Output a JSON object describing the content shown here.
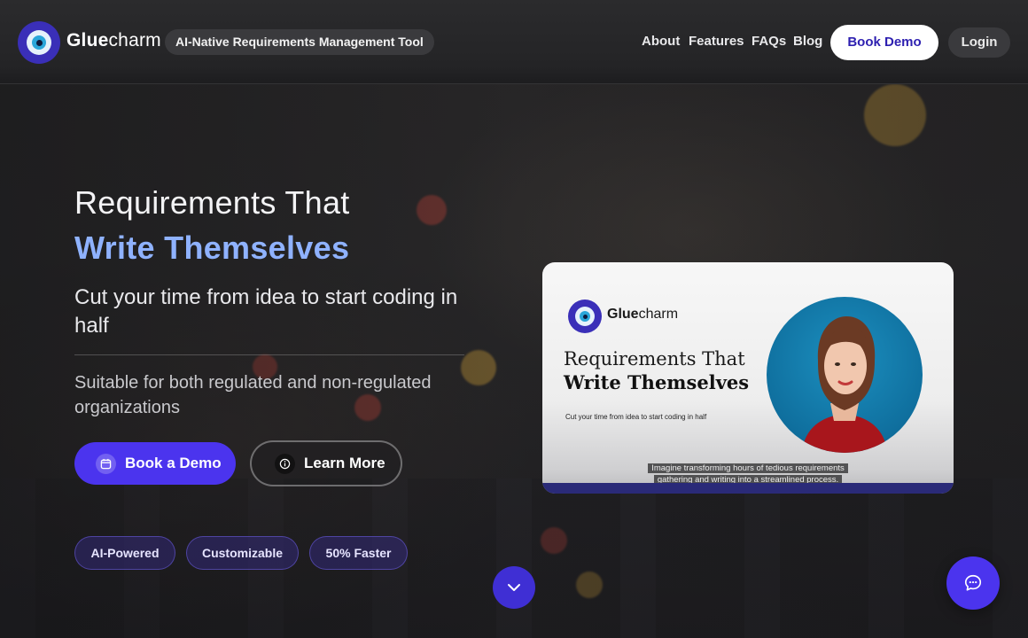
{
  "header": {
    "brand_bold": "Glue",
    "brand_light": "charm",
    "tagline": "AI-Native Requirements Management Tool",
    "nav": [
      {
        "label": "About"
      },
      {
        "label": "Features"
      },
      {
        "label": "FAQs"
      },
      {
        "label": "Blog"
      }
    ],
    "book_demo_label": "Book Demo",
    "login_label": "Login"
  },
  "hero": {
    "title_line1": "Requirements That",
    "title_line2": "Write Themselves",
    "subtitle": "Cut your time from idea to start coding in half",
    "description": "Suitable for both regulated and non-regulated organizations",
    "primary_button": "Book a Demo",
    "secondary_button": "Learn More",
    "chips": [
      "AI-Powered",
      "Customizable",
      "50% Faster"
    ]
  },
  "video": {
    "brand_bold": "Glue",
    "brand_light": "charm",
    "title_line1": "Requirements That",
    "title_line2": "Write Themselves",
    "tagline": "Cut your time from idea to start coding in half",
    "caption_line1": "Imagine transforming hours of tedious requirements",
    "caption_line2": "gathering and writing into a streamlined process."
  },
  "icons": {
    "primary_button_icon": "calendar-icon",
    "secondary_button_icon": "info-icon",
    "scroll": "chevron-down-icon",
    "chat": "chat-bubble-icon"
  },
  "colors": {
    "accent": "#4b34ee",
    "headline_blue": "#8fb2ff",
    "demo_text": "#2d1fb0"
  }
}
